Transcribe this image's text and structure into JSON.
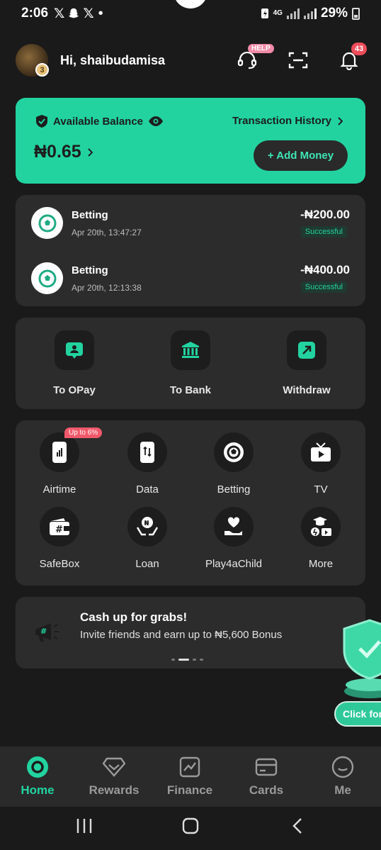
{
  "status_bar": {
    "time": "2:06",
    "network": "4G",
    "battery": "29%"
  },
  "header": {
    "greeting": "Hi, shaibudamisa",
    "avatar_level": "3",
    "help_tag": "HELP",
    "notification_count": "43"
  },
  "balance": {
    "label": "Available Balance",
    "history_label": "Transaction History",
    "amount": "₦0.65",
    "add_money_label": "+ Add Money"
  },
  "transactions": [
    {
      "title": "Betting",
      "date": "Apr 20th, 13:47:27",
      "amount": "-₦200.00",
      "status": "Successful"
    },
    {
      "title": "Betting",
      "date": "Apr 20th, 12:13:38",
      "amount": "-₦400.00",
      "status": "Successful"
    }
  ],
  "transfers": [
    {
      "label": "To OPay",
      "icon": "opay-user-icon"
    },
    {
      "label": "To Bank",
      "icon": "bank-icon"
    },
    {
      "label": "Withdraw",
      "icon": "withdraw-icon"
    }
  ],
  "services": [
    {
      "label": "Airtime",
      "icon": "phone-airtime-icon",
      "badge": "Up to 6%"
    },
    {
      "label": "Data",
      "icon": "phone-data-icon"
    },
    {
      "label": "Betting",
      "icon": "soccer-ball-icon"
    },
    {
      "label": "TV",
      "icon": "tv-icon"
    },
    {
      "label": "SafeBox",
      "icon": "safebox-wallet-icon"
    },
    {
      "label": "Loan",
      "icon": "loan-hands-icon"
    },
    {
      "label": "Play4aChild",
      "icon": "heart-hand-icon"
    },
    {
      "label": "More",
      "icon": "more-grid-icon"
    }
  ],
  "promo": {
    "title": "Cash up for grabs!",
    "subtitle": "Invite friends and earn up to ₦5,600 Bonus"
  },
  "floating": {
    "label": "Click for"
  },
  "bottom_nav": [
    {
      "label": "Home",
      "active": true
    },
    {
      "label": "Rewards"
    },
    {
      "label": "Finance"
    },
    {
      "label": "Cards"
    },
    {
      "label": "Me"
    }
  ],
  "colors": {
    "accent": "#22d3a0",
    "background": "#1a1a1a",
    "panel": "#2c2c2c",
    "badge_red": "#ef4c5c"
  }
}
